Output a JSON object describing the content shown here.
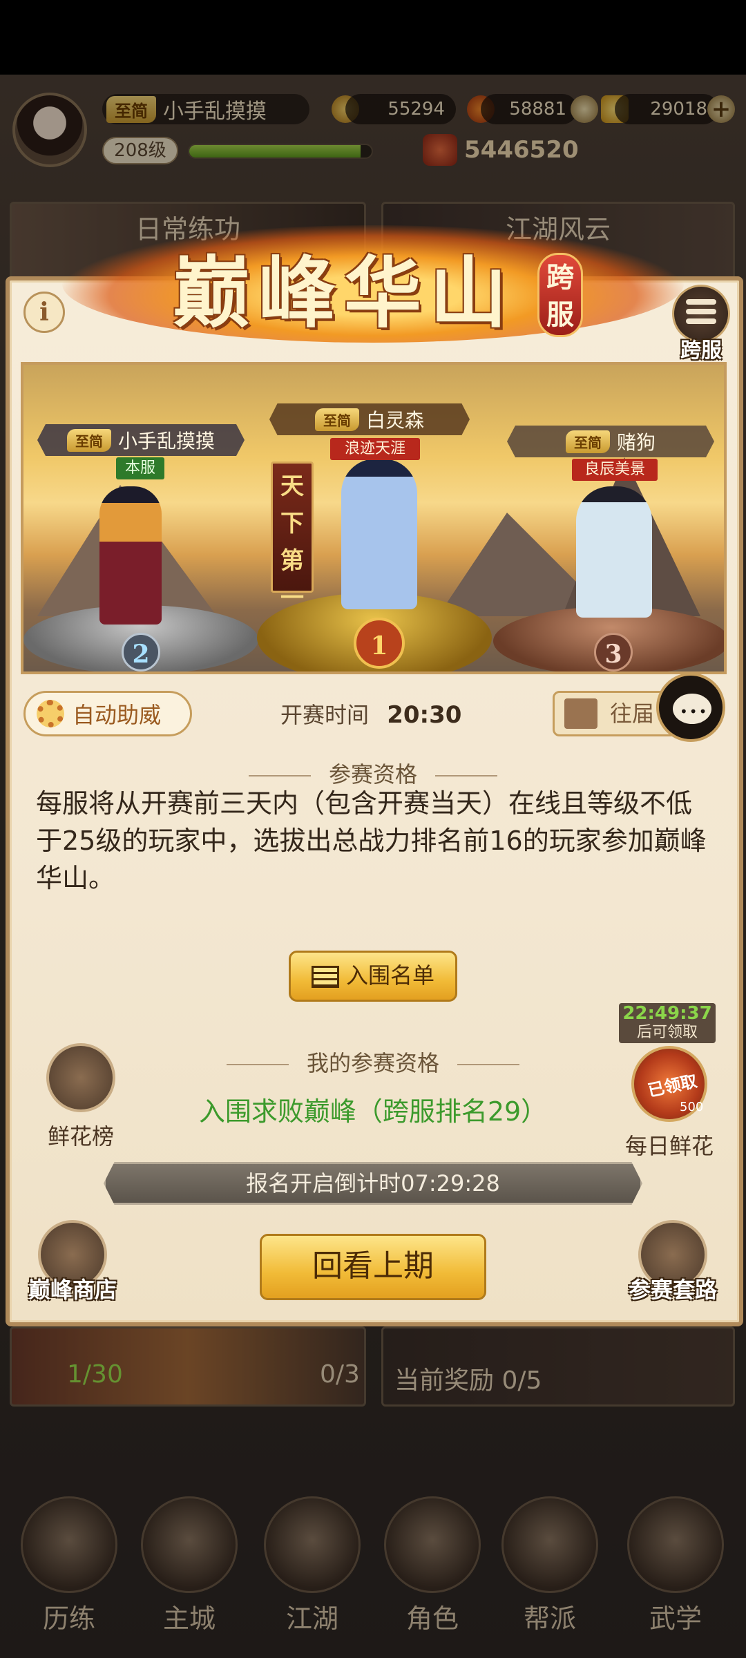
{
  "player": {
    "tag": "至简",
    "name": "小手乱摸摸",
    "level": "208级",
    "exp_progress": 0.94,
    "power": "5446520"
  },
  "resources": {
    "coins": "55294",
    "gems": "58881",
    "gold": "29018"
  },
  "background": {
    "tile_daily": "日常练功",
    "tile_jianghu": "江湖风云",
    "tile_stamina": "1/30",
    "tile_count": "0/3",
    "tile_reward": "当前奖励 0/5"
  },
  "bottom_nav": [
    {
      "label": "历练"
    },
    {
      "label": "主城"
    },
    {
      "label": "江湖"
    },
    {
      "label": "角色"
    },
    {
      "label": "帮派"
    },
    {
      "label": "武学"
    }
  ],
  "panel": {
    "title": "巅峰华山",
    "badge": "跨服",
    "info_label": "i",
    "kuafu_label": "跨服",
    "podium": {
      "tianxia": "天下第一",
      "rank1": {
        "tag": "至简",
        "name": "白灵森",
        "title": "浪迹天涯",
        "rank": "1"
      },
      "rank2": {
        "tag": "至简",
        "name": "小手乱摸摸",
        "title": "本服",
        "rank": "2"
      },
      "rank3": {
        "tag": "至简",
        "name": "赌狗",
        "title": "良辰美景",
        "rank": "3"
      }
    },
    "auto_btn": "自动助威",
    "start_label": "开赛时间",
    "start_time": "20:30",
    "past_btn": "往届",
    "rules_title": "参赛资格",
    "rules_text": "每服将从开赛前三天内（包含开赛当天）在线且等级不低于25级的玩家中，选拔出总战力排名前16的玩家参加巅峰华山。",
    "list_btn": "入围名单",
    "flower_rank": "鲜花榜",
    "my_title": "我的参赛资格",
    "my_status": "入围求败巅峰（跨服排名29）",
    "timer": "22:49:37",
    "timer_sub": "后可领取",
    "claimed": "已领取",
    "flower_count": "500",
    "daily_flower": "每日鲜花",
    "countdown": "报名开启倒计时07:29:28",
    "shop": "巅峰商店",
    "review_btn": "回看上期",
    "strategy": "参赛套路"
  },
  "colors": {
    "accent_gold": "#f1bb37",
    "qualify_green": "#3c9a2c",
    "timer_green": "#8bd64a"
  }
}
